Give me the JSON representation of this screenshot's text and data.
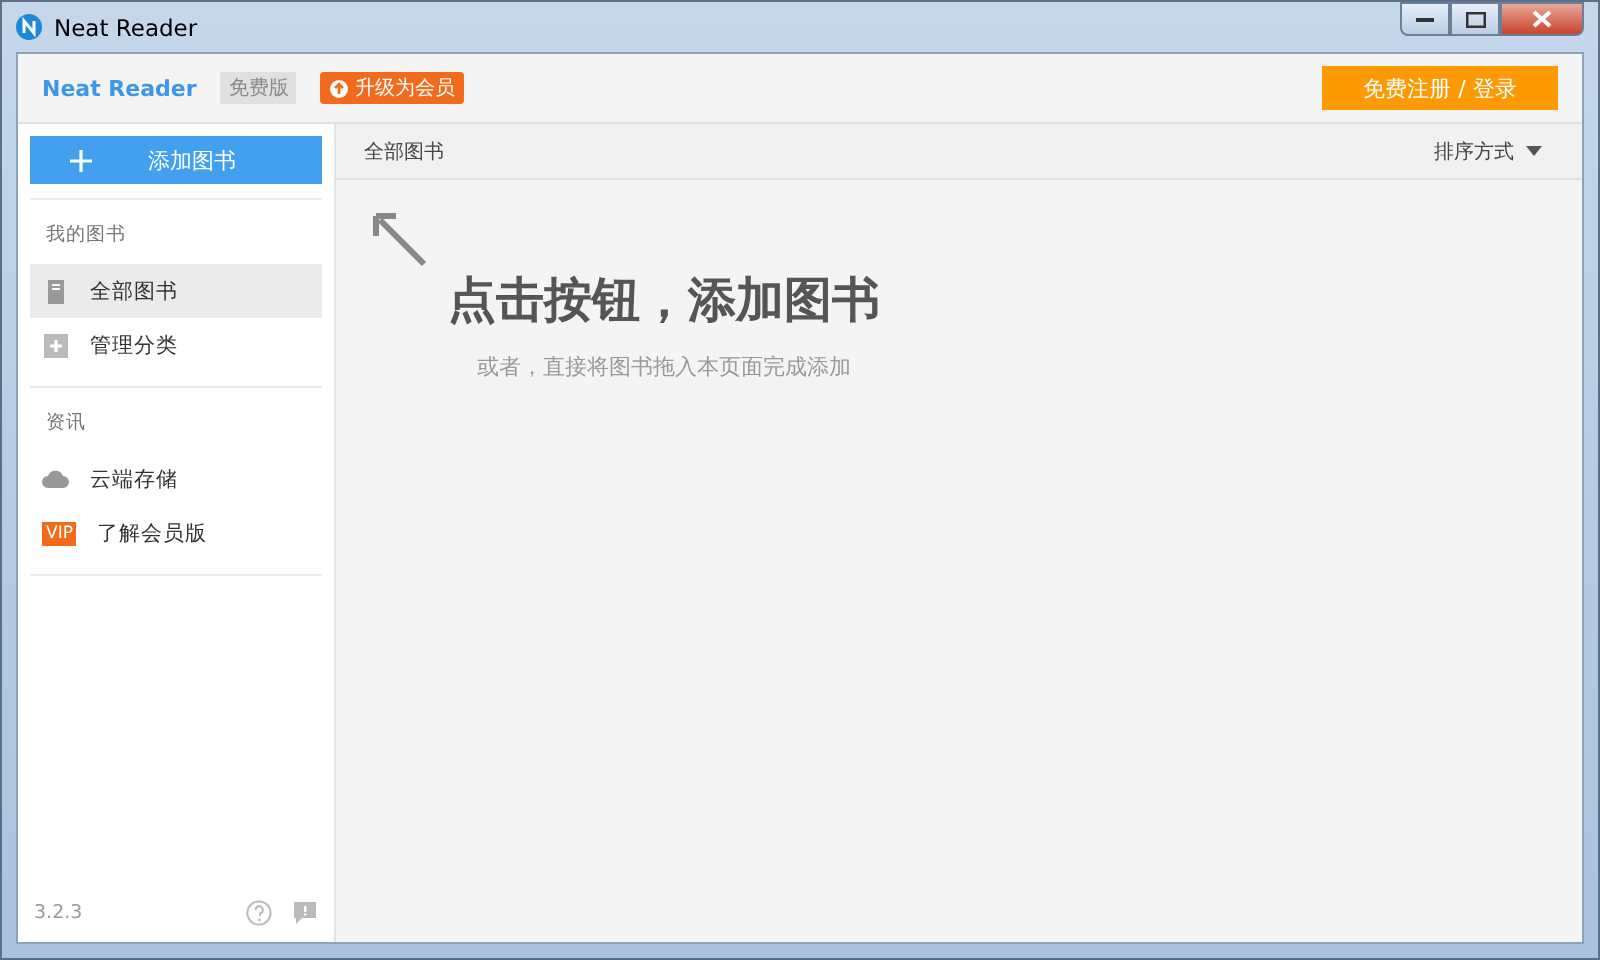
{
  "window": {
    "title": "Neat Reader"
  },
  "header": {
    "brand": "Neat Reader",
    "edition_badge": "免费版",
    "upgrade_button": "升级为会员",
    "login_button": "免费注册 / 登录"
  },
  "sidebar": {
    "add_button": "添加图书",
    "sections": [
      {
        "heading": "我的图书",
        "items": [
          {
            "label": "全部图书",
            "kind": "book",
            "selected": true
          },
          {
            "label": "管理分类",
            "kind": "add",
            "selected": false
          }
        ]
      },
      {
        "heading": "资讯",
        "items": [
          {
            "label": "云端存储",
            "kind": "cloud",
            "selected": false
          },
          {
            "label": "了解会员版",
            "kind": "vip",
            "badge": "VIP",
            "selected": false
          }
        ]
      }
    ],
    "version": "3.2.3"
  },
  "content": {
    "title": "全部图书",
    "sort_button": "排序方式",
    "empty_title": "点击按钮，添加图书",
    "empty_hint": "或者，直接将图书拖入本页面完成添加"
  }
}
